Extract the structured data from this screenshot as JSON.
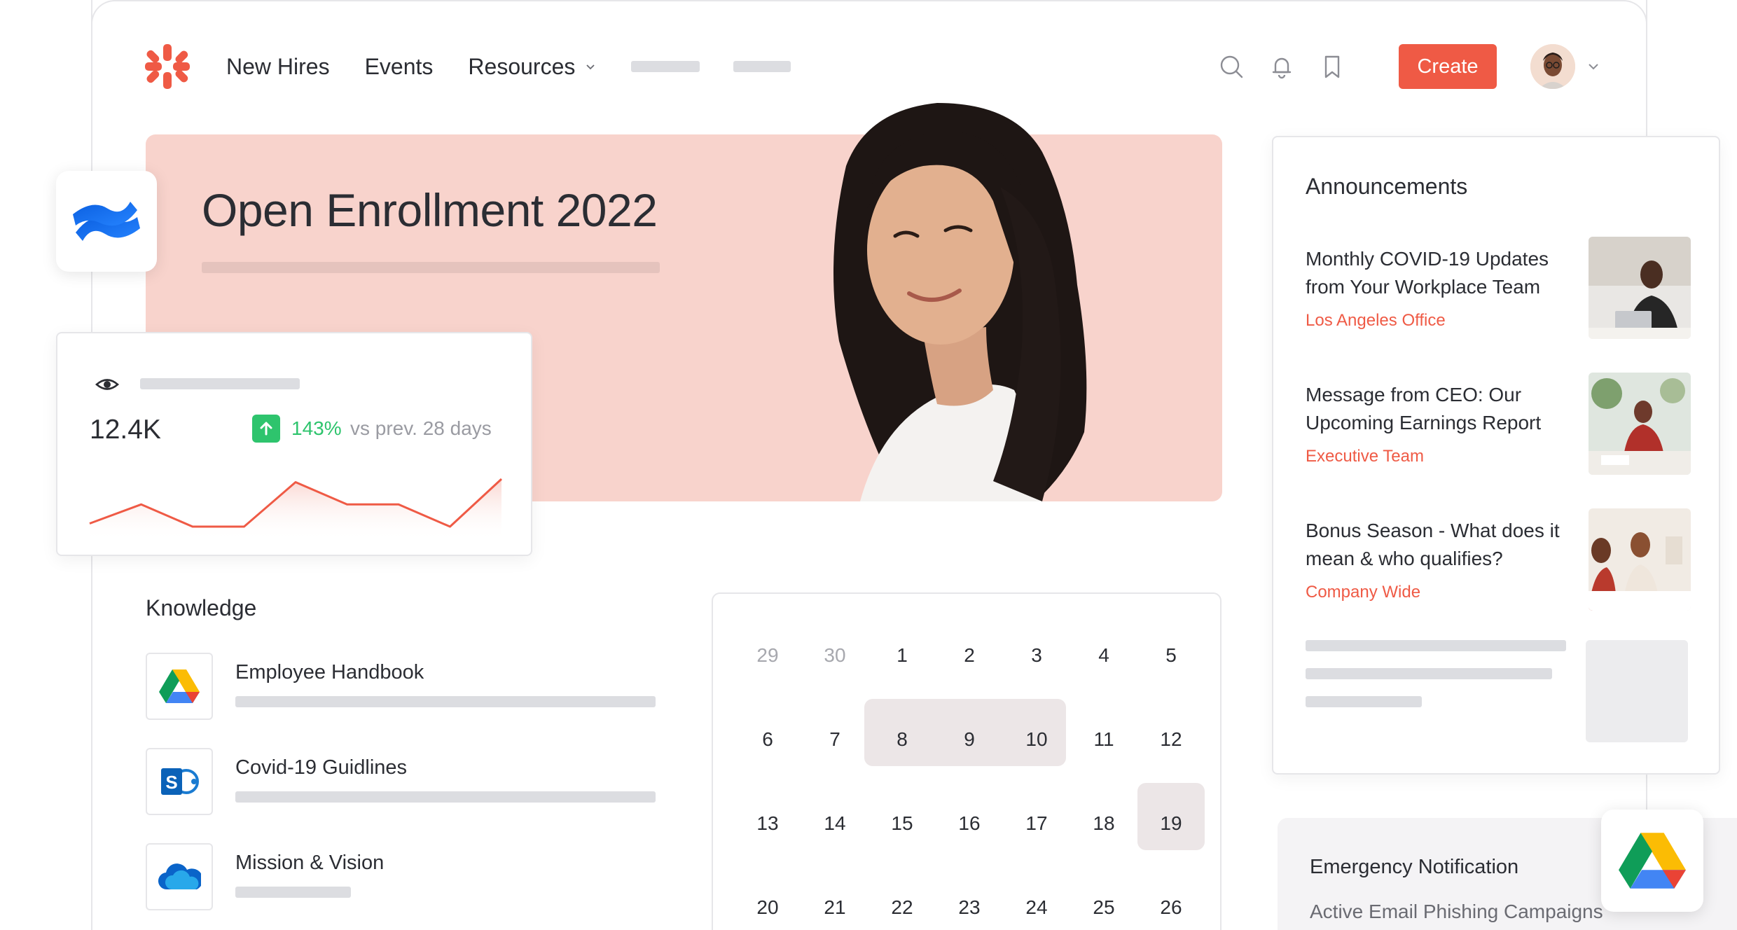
{
  "nav": {
    "links": [
      {
        "label": "New Hires"
      },
      {
        "label": "Events"
      },
      {
        "label": "Resources"
      }
    ],
    "create_label": "Create",
    "icons": [
      "search-icon",
      "bell-icon",
      "bookmark-icon"
    ],
    "brand_color": "#ef5a45"
  },
  "hero": {
    "title": "Open Enrollment 2022",
    "background": "#f8d3cc"
  },
  "stats": {
    "value": "12.4K",
    "change": "143%",
    "comparison": "vs prev. 28 days",
    "trend_color": "#2ec46d",
    "series": [
      2,
      8,
      1,
      1,
      15,
      8,
      8,
      1,
      16
    ]
  },
  "knowledge": {
    "title": "Knowledge",
    "items": [
      {
        "label": "Employee Handbook",
        "icon": "google-drive-icon"
      },
      {
        "label": "Covid-19 Guidlines",
        "icon": "sharepoint-icon"
      },
      {
        "label": "Mission & Vision",
        "icon": "onedrive-icon"
      }
    ]
  },
  "calendar": {
    "days": [
      {
        "d": "29",
        "muted": true
      },
      {
        "d": "30",
        "muted": true
      },
      {
        "d": "1"
      },
      {
        "d": "2"
      },
      {
        "d": "3"
      },
      {
        "d": "4"
      },
      {
        "d": "5"
      },
      {
        "d": "6"
      },
      {
        "d": "7"
      },
      {
        "d": "8",
        "selected": true
      },
      {
        "d": "9",
        "selected": true
      },
      {
        "d": "10",
        "selected": true
      },
      {
        "d": "11"
      },
      {
        "d": "12"
      },
      {
        "d": "13"
      },
      {
        "d": "14"
      },
      {
        "d": "15"
      },
      {
        "d": "16"
      },
      {
        "d": "17"
      },
      {
        "d": "18"
      },
      {
        "d": "19",
        "selected": true
      },
      {
        "d": "20"
      },
      {
        "d": "21"
      },
      {
        "d": "22"
      },
      {
        "d": "23"
      },
      {
        "d": "24"
      },
      {
        "d": "25"
      },
      {
        "d": "26"
      }
    ]
  },
  "announcements": {
    "title": "Announcements",
    "items": [
      {
        "headline": "Monthly COVID-19 Updates from Your Workplace Team",
        "source": "Los Angeles Office"
      },
      {
        "headline": "Message from CEO: Our Upcoming Earnings Report",
        "source": "Executive Team"
      },
      {
        "headline": "Bonus Season - What does it mean & who qualifies?",
        "source": "Company Wide"
      }
    ]
  },
  "emergency": {
    "title": "Emergency Notification",
    "subtitle": "Active Email Phishing Campaigns"
  }
}
